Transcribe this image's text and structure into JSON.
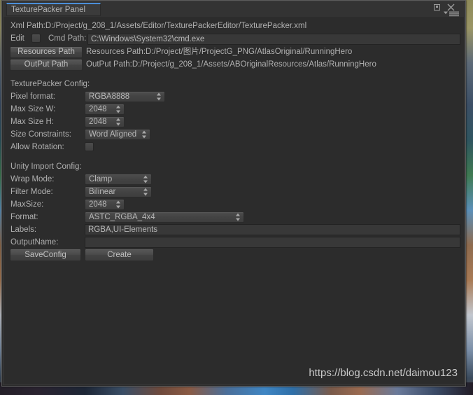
{
  "window": {
    "tab_label": "TexturePacker Panel",
    "buttons": {
      "maximize": "maximize-restore",
      "close": "close",
      "menu": "panel-menu"
    },
    "accent_color": "#4b8ed8",
    "background_color": "#2c2c2c"
  },
  "header": {
    "xml_path_text": "Xml Path:D:/Project/g_208_1/Assets/Editor/TexturePackerEditor/TexturePacker.xml",
    "edit_label": "Edit",
    "edit_checked": false,
    "cmd_path_label": "Cmd Path:",
    "cmd_path_value": "C:\\Windows\\System32\\cmd.exe",
    "resources_path_button": "Resources Path",
    "resources_path_text": "Resources Path:D:/Project/图片/ProjectG_PNG/AtlasOriginal/RunningHero",
    "output_path_button": "OutPut Path",
    "output_path_text": "OutPut Path:D:/Project/g_208_1/Assets/ABOriginalResources/Atlas/RunningHero"
  },
  "texturepacker_config": {
    "title": "TexturePacker Config:",
    "pixel_format": {
      "label": "Pixel format:",
      "value": "RGBA8888"
    },
    "max_size_w": {
      "label": "Max Size W:",
      "value": "2048"
    },
    "max_size_h": {
      "label": "Max Size H:",
      "value": "2048"
    },
    "size_constraints": {
      "label": "Size Constraints:",
      "value": "Word Aligned"
    },
    "allow_rotation": {
      "label": "Allow Rotation:",
      "checked": false
    }
  },
  "unity_import_config": {
    "title": "Unity Import Config:",
    "wrap_mode": {
      "label": "Wrap Mode:",
      "value": "Clamp"
    },
    "filter_mode": {
      "label": "Filter Mode:",
      "value": "Bilinear"
    },
    "max_size": {
      "label": "MaxSize:",
      "value": "2048"
    },
    "format": {
      "label": "Format:",
      "value": "ASTC_RGBA_4x4"
    },
    "labels": {
      "label": "Labels:",
      "value": "RGBA,UI-Elements"
    },
    "output_name": {
      "label": "OutputName:",
      "value": ""
    }
  },
  "actions": {
    "save_config": "SaveConfig",
    "create": "Create"
  },
  "watermark": {
    "text": "https://blog.csdn.net/daimou123"
  }
}
